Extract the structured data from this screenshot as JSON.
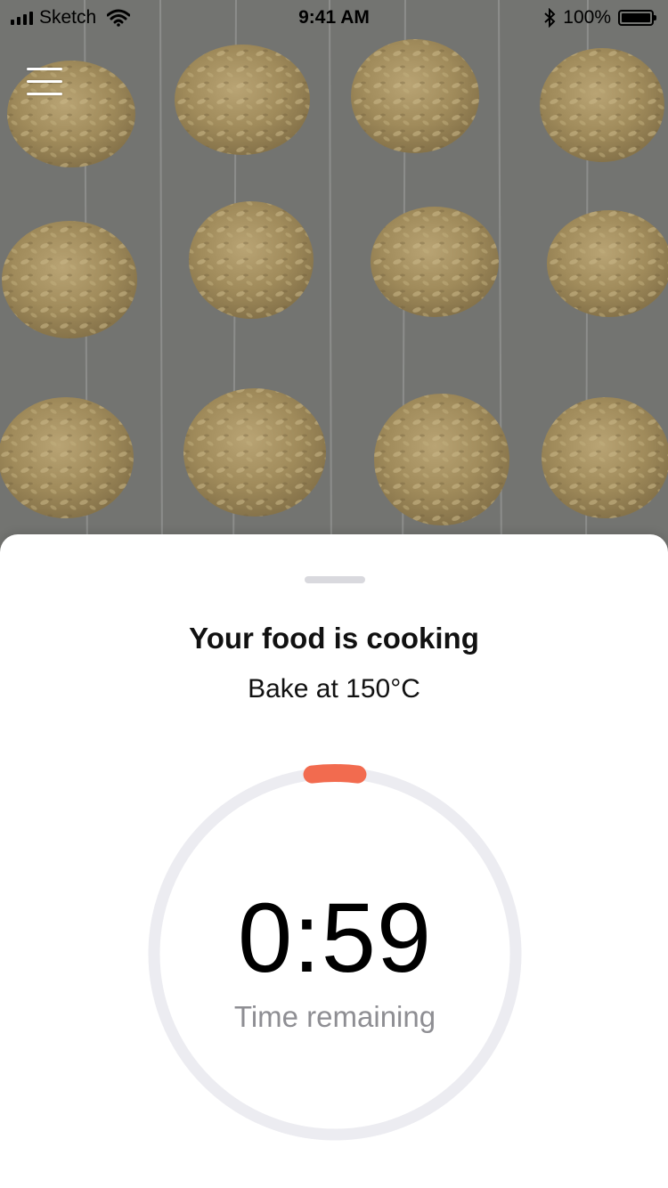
{
  "status_bar": {
    "carrier": "Sketch",
    "time": "9:41 AM",
    "battery": "100%",
    "icons": [
      "signal-icon",
      "wifi-icon",
      "bluetooth-icon",
      "battery-icon"
    ]
  },
  "camera": {
    "icon": "menu-icon"
  },
  "sheet": {
    "title": "Your food is cooking",
    "subtitle": "Bake at 150°C",
    "timer": {
      "value": "0:59",
      "label": "Time remaining",
      "progress": 0.04
    }
  },
  "colors": {
    "accent": "#f26b4f",
    "ring_track": "#ececf1",
    "muted_text": "#8e8e93",
    "tray": "#737471",
    "cookie": "#a6905f"
  }
}
